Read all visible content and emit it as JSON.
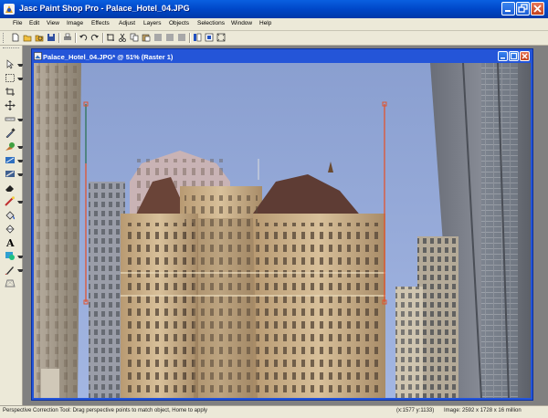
{
  "window": {
    "title": "Jasc Paint Shop Pro - Palace_Hotel_04.JPG"
  },
  "menu": {
    "items": [
      "File",
      "Edit",
      "View",
      "Image",
      "Effects",
      "Adjust",
      "Layers",
      "Objects",
      "Selections",
      "Window",
      "Help"
    ]
  },
  "toolbar": {
    "icons": [
      "new-icon",
      "open-icon",
      "browse-icon",
      "save-icon",
      "print-icon",
      "undo-icon",
      "redo-icon",
      "crop-icon",
      "cut-icon",
      "copy-icon",
      "paste-icon",
      "paste-layer-icon",
      "paste-selection-icon",
      "paste-transparent-icon",
      "toggle-palettes-icon",
      "full-screen-icon",
      "full-edit-icon"
    ]
  },
  "tools": {
    "icons": [
      "pan-icon",
      "selection-icon",
      "crop-icon",
      "move-icon",
      "straighten-icon",
      "dropper-icon",
      "clone-icon",
      "scratch-remover-icon",
      "retouch-icon",
      "eraser-icon",
      "picture-tube-icon",
      "fill-icon",
      "text-icon",
      "preset-shape-icon",
      "pen-icon",
      "perspective-icon"
    ]
  },
  "document": {
    "title": "Palace_Hotel_04.JPG* @ 51% (Raster 1)"
  },
  "status": {
    "hint": "Perspective Correction Tool: Drag perspective points to match object, Home to apply",
    "coords": "(x:1577 y:1133)",
    "image_info": "Image: 2592 x 1728 x 16 million"
  },
  "colors": {
    "title_bar": "#0047c8",
    "doc_border": "#2455d8",
    "guide_line": "#e05530",
    "sky": "#8aa0d0"
  }
}
